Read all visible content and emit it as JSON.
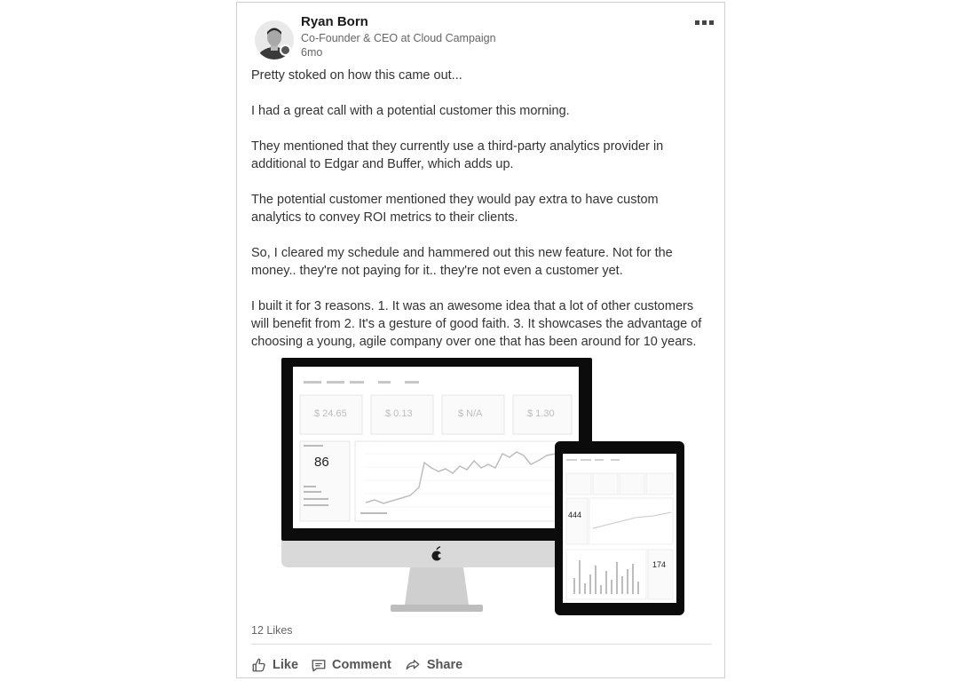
{
  "post": {
    "author": {
      "name": "Ryan Born",
      "headline": "Co-Founder & CEO at Cloud Campaign",
      "time": "6mo"
    },
    "paragraphs": [
      "Pretty stoked on how this came out...",
      "I had a great call with a potential customer this morning.",
      "They mentioned that they currently use a third-party analytics provider in\nadditional to Edgar and Buffer, which adds up.",
      "The potential customer mentioned they would pay extra to have custom\nanalytics to convey ROI metrics to their clients.",
      "So, I cleared my schedule and hammered out this new feature.  Not for the\nmoney.. they're not paying for it.. they're not even a customer yet.",
      "I built it for 3 reasons. 1. It was an awesome idea that a lot of other customers\nwill benefit from 2. It's a gesture of good faith. 3. It showcases the advantage of\nchoosing a young, agile company over one that has been around for 10 years."
    ],
    "image": {
      "desktop_stats": [
        "$ 24.65",
        "$ 0.13",
        "$ N/A",
        "$ 1.30"
      ],
      "desktop_big_number": "86",
      "tablet_big_number": "444",
      "tablet_side_number": "174"
    },
    "likes": "12 Likes",
    "actions": {
      "like": "Like",
      "comment": "Comment",
      "share": "Share"
    }
  }
}
